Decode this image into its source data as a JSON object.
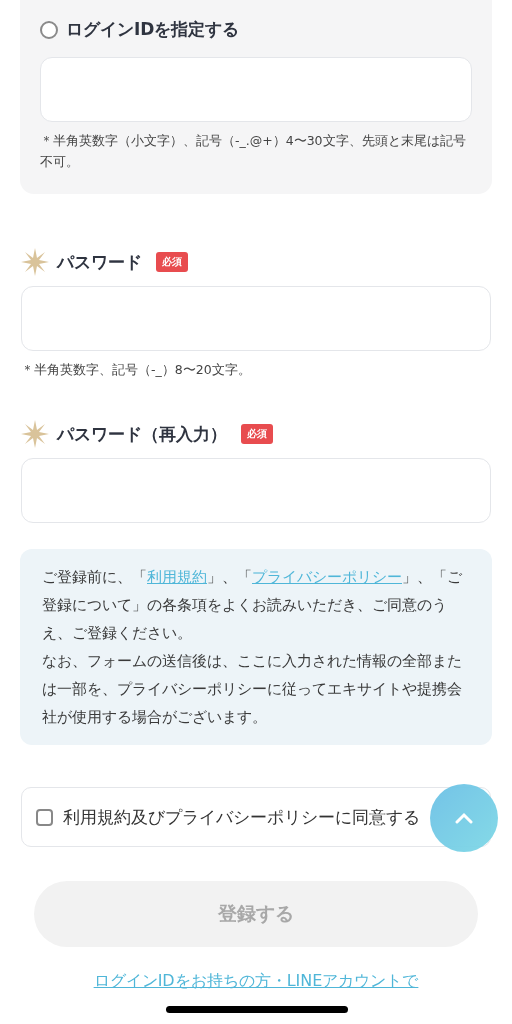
{
  "login_id_option": {
    "label": "ログインIDを指定する",
    "selected": false,
    "hint": "＊半角英数字（小文字）、記号（-_.@+）4〜30文字、先頭と末尾は記号不可。"
  },
  "fields": [
    {
      "label": "パスワード",
      "badge": "必須",
      "hint": "＊半角英数字、記号（-_）8〜20文字。"
    },
    {
      "label": "パスワード（再入力）",
      "badge": "必須"
    }
  ],
  "notice": {
    "paragraphs": [
      [
        {
          "kind": "text",
          "text": "ご登録前に、「"
        },
        {
          "kind": "link",
          "text": "利用規約"
        },
        {
          "kind": "text",
          "text": "」、「"
        },
        {
          "kind": "link",
          "text": "プライバシーポリシー"
        },
        {
          "kind": "text",
          "text": "」、「ご登録について」の各条項をよくお読みいただき、ご同意のうえ、ご登録ください。"
        }
      ],
      [
        {
          "kind": "text",
          "text": "なお、フォームの送信後は、ここに入力された情報の全部または一部を、プライバシーポリシーに従ってエキサイトや提携会社が使用する場合がございます。"
        }
      ]
    ]
  },
  "agree": {
    "label": "利用規約及びプライバシーポリシーに同意する",
    "checked": false
  },
  "submit": {
    "label": "登録する",
    "disabled": true
  },
  "login_link": [
    "ログインIDをお持ちの方・LINEアカウントで"
  ]
}
